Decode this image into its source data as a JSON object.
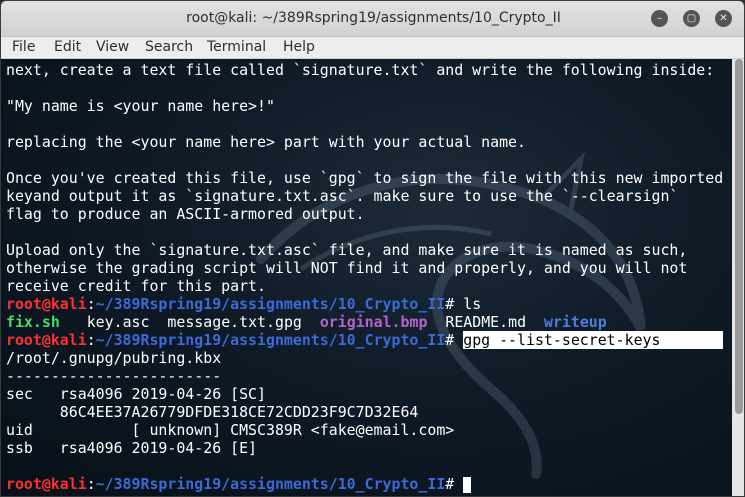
{
  "window": {
    "title": "root@kali: ~/389Rspring19/assignments/10_Crypto_II",
    "minimize_glyph": "–",
    "maximize_glyph": "▢",
    "close_glyph": "✕"
  },
  "menu": [
    "File",
    "Edit",
    "View",
    "Search",
    "Terminal",
    "Help"
  ],
  "prompt": {
    "user": "root@kali",
    "sep": ":",
    "path": "~/389Rspring19/assignments/10_Crypto_II",
    "hash": "# "
  },
  "text_lines": [
    "next, create a text file called `signature.txt` and write the following inside:",
    "",
    "\"My name is <your name here>!\"",
    "",
    "replacing the <your name here> part with your actual name.",
    "",
    "Once you've created this file, use `gpg` to sign the file with this new imported",
    "keyand output it as `signature.txt.asc`. make sure to use the `--clearsign`",
    "flag to produce an ASCII-armored output.",
    "",
    "Upload only the `signature.txt.asc` file, and make sure it is named as such,",
    "otherwise the grading script will NOT find it and properly, and you will not",
    "receive credit for this part."
  ],
  "cmd1": "ls",
  "ls_output": {
    "fix": "fix.sh",
    "key": "key.asc",
    "msg": "message.txt.gpg",
    "orig": "original.bmp",
    "readme": "README.md",
    "writeup": "writeup"
  },
  "cmd2": "gpg --list-secret-keys",
  "gpg_output": [
    "/root/.gnupg/pubring.kbx",
    "------------------------",
    "sec   rsa4096 2019-04-26 [SC]",
    "      86C4EE37A26779DFDE318CE72CDD23F9C7D32E64",
    "uid           [ unknown] CMSC389R <fake@email.com>",
    "ssb   rsa4096 2019-04-26 [E]",
    ""
  ],
  "colors": {
    "prompt_user": "#ff3030",
    "prompt_path": "#3c6bd8",
    "executable": "#4cd964",
    "image": "#b764c8",
    "directory": "#4b7fe0"
  }
}
